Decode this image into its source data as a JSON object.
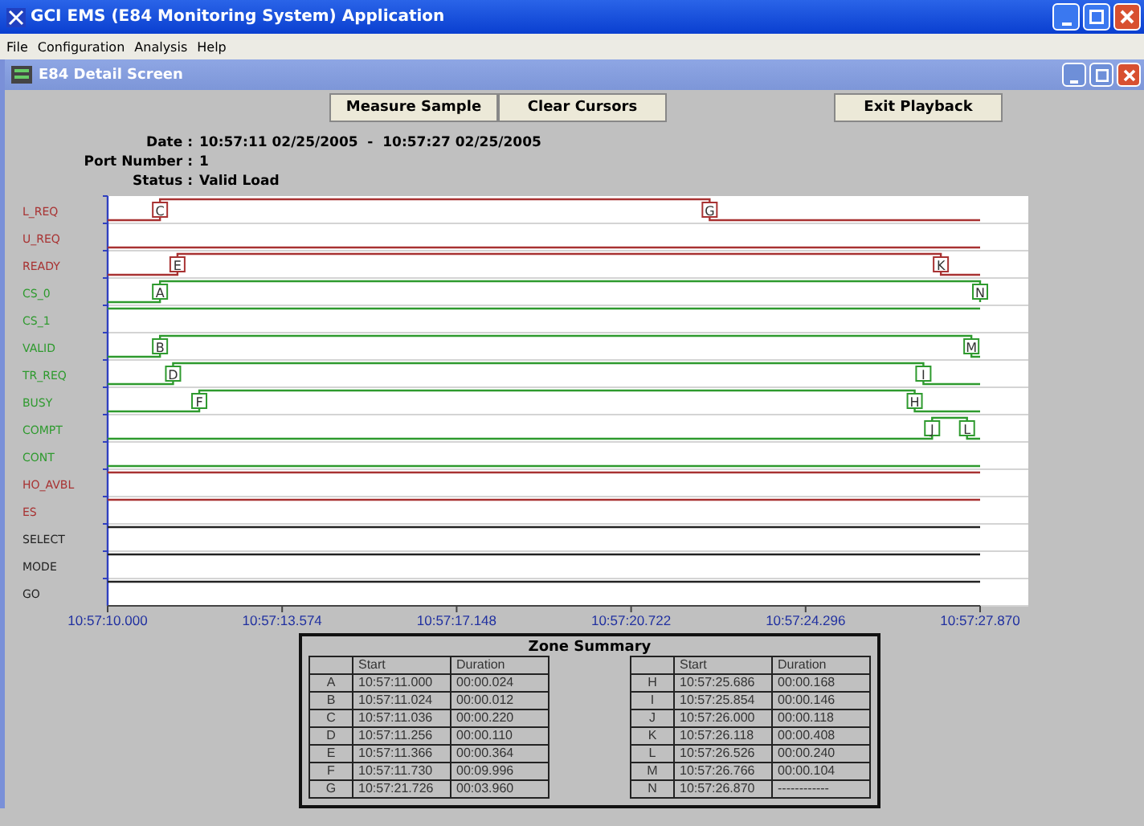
{
  "window": {
    "title": "GCI EMS (E84 Monitoring System) Application"
  },
  "menu": [
    "File",
    "Configuration",
    "Analysis",
    "Help"
  ],
  "child_window": {
    "title": "E84 Detail Screen"
  },
  "toolbar": {
    "left_buttons": [
      "Measure Sample",
      "Clear Cursors"
    ],
    "right_buttons": [
      "Exit Playback"
    ]
  },
  "info": [
    {
      "label": "Date :",
      "value": "10:57:11 02/25/2005  -  10:57:27 02/25/2005"
    },
    {
      "label": "Port Number :",
      "value": "1"
    },
    {
      "label": "Status :",
      "value": "Valid Load"
    }
  ],
  "signals": [
    {
      "name": "L_REQ",
      "color": "#a83232",
      "markers": [
        "C",
        "G"
      ]
    },
    {
      "name": "U_REQ",
      "color": "#a83232"
    },
    {
      "name": "READY",
      "color": "#a83232",
      "markers": [
        "E",
        "K"
      ]
    },
    {
      "name": "CS_0",
      "color": "#2e9a2e",
      "markers": [
        "A",
        "N"
      ]
    },
    {
      "name": "CS_1",
      "color": "#2e9a2e"
    },
    {
      "name": "VALID",
      "color": "#2e9a2e",
      "markers": [
        "B",
        "M"
      ]
    },
    {
      "name": "TR_REQ",
      "color": "#2e9a2e",
      "markers": [
        "D",
        "I"
      ]
    },
    {
      "name": "BUSY",
      "color": "#2e9a2e",
      "markers": [
        "F",
        "H"
      ]
    },
    {
      "name": "COMPT",
      "color": "#2e9a2e",
      "markers": [
        "J",
        "L"
      ]
    },
    {
      "name": "CONT",
      "color": "#2e9a2e"
    },
    {
      "name": "HO_AVBL",
      "color": "#a83232"
    },
    {
      "name": "ES",
      "color": "#a83232"
    },
    {
      "name": "SELECT",
      "color": "#222222"
    },
    {
      "name": "MODE",
      "color": "#222222"
    },
    {
      "name": "GO",
      "color": "#222222"
    }
  ],
  "time_axis": [
    "10:57:10.000",
    "10:57:13.574",
    "10:57:17.148",
    "10:57:20.722",
    "10:57:24.296",
    "10:57:27.870"
  ],
  "zone_summary": {
    "title": "Zone Summary",
    "tables": [
      {
        "columns": [
          "Start",
          "Duration"
        ],
        "rows": [
          {
            "zone": "A",
            "start": "10:57:11.000",
            "duration": "00:00.024"
          },
          {
            "zone": "B",
            "start": "10:57:11.024",
            "duration": "00:00.012"
          },
          {
            "zone": "C",
            "start": "10:57:11.036",
            "duration": "00:00.220"
          },
          {
            "zone": "D",
            "start": "10:57:11.256",
            "duration": "00:00.110"
          },
          {
            "zone": "E",
            "start": "10:57:11.366",
            "duration": "00:00.364"
          },
          {
            "zone": "F",
            "start": "10:57:11.730",
            "duration": "00:09.996"
          },
          {
            "zone": "G",
            "start": "10:57:21.726",
            "duration": "00:03.960"
          }
        ]
      },
      {
        "columns": [
          "Start",
          "Duration"
        ],
        "rows": [
          {
            "zone": "H",
            "start": "10:57:25.686",
            "duration": "00:00.168"
          },
          {
            "zone": "I",
            "start": "10:57:25.854",
            "duration": "00:00.146"
          },
          {
            "zone": "J",
            "start": "10:57:26.000",
            "duration": "00:00.118"
          },
          {
            "zone": "K",
            "start": "10:57:26.118",
            "duration": "00:00.408"
          },
          {
            "zone": "L",
            "start": "10:57:26.526",
            "duration": "00:00.240"
          },
          {
            "zone": "M",
            "start": "10:57:26.766",
            "duration": "00:00.104"
          },
          {
            "zone": "N",
            "start": "10:57:26.870",
            "duration": "------------"
          }
        ]
      }
    ]
  }
}
